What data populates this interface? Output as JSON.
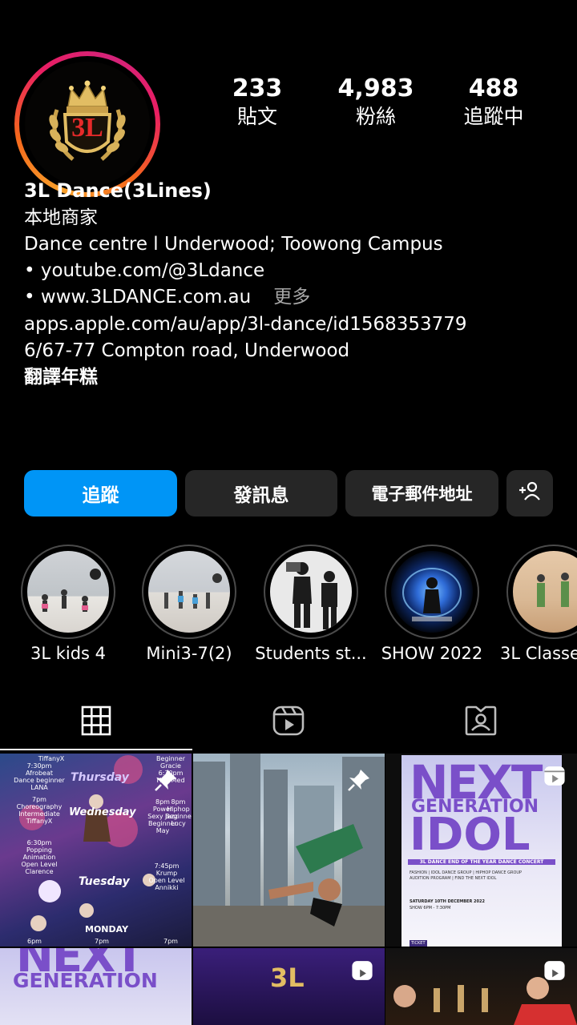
{
  "profile": {
    "logo_text": "3L",
    "stats": [
      {
        "value": "233",
        "label": "貼文"
      },
      {
        "value": "4,983",
        "label": "粉絲"
      },
      {
        "value": "488",
        "label": "追蹤中"
      }
    ],
    "name": "3L Dance(3Lines)",
    "category": "本地商家",
    "bio_line1": "Dance centre l Underwood; Toowong Campus",
    "bio_line2": "• youtube.com/@3Ldance",
    "bio_line3": "• www.3LDANCE.com.au",
    "more_label": "更多",
    "link": "apps.apple.com/au/app/3l-dance/id1568353779",
    "address": "6/67-77 Compton road, Underwood",
    "translate_label": "翻譯年糕"
  },
  "actions": {
    "follow": "追蹤",
    "message": "發訊息",
    "email": "電子郵件地址",
    "add_user_icon": "add-person-icon"
  },
  "highlights": [
    {
      "label": "3L kids 4"
    },
    {
      "label": "Mini3-7(2)"
    },
    {
      "label": "Students st..."
    },
    {
      "label": "SHOW 2022"
    },
    {
      "label": "3L Classe"
    }
  ],
  "tabs": [
    {
      "icon": "grid-icon",
      "active": true
    },
    {
      "icon": "reels-icon",
      "active": false
    },
    {
      "icon": "tagged-icon",
      "active": false
    }
  ],
  "posts": {
    "p1_days": [
      "Thursday",
      "Wednesday",
      "Tuesday",
      "MONDAY"
    ],
    "p1_text": [
      "TiffanyX",
      "7:30pm",
      "Afrobeat",
      "Dance beginner",
      "LANA",
      "7pm",
      "Choreography",
      "Intermediate",
      "TiffanyX",
      "6:30pm",
      "Popping",
      "Animation",
      "Open Level",
      "Clarence",
      "Beginner",
      "Gracie",
      "6:30pm",
      "HiIT/Med",
      "8pm",
      "Power",
      "Sexy Jazz",
      "Beginner",
      "May",
      "8pm",
      "Hiphop",
      "Beginner",
      "Lucy",
      "7:45pm",
      "Krump",
      "Open Level",
      "Annikki",
      "6pm",
      "7pm",
      "7pm"
    ],
    "p3_title1": "NEXT",
    "p3_title2": "GENERATION",
    "p3_title3": "IDOL",
    "p3_sub": "3L DANCE END OF THE YEAR DANCE CONCERT",
    "p3_sub2": "FASHION | IDOL DANCE GROUP | HIPHOP DANCE GROUP",
    "p3_sub3": "AUDITION PROGRAM | FIND THE NEXT IDOL",
    "p3_date": "SATURDAY 10TH DECEMBER 2022",
    "p3_time": "SHOW 6PM - 7:30PM",
    "p3_ticket": "TICKET",
    "p4_title1": "NEXT",
    "p4_title2": "GENERATION",
    "p5_logo": "3L"
  },
  "colors": {
    "accent": "#0095f6",
    "button": "#262626",
    "muted": "#a8a8a8"
  }
}
